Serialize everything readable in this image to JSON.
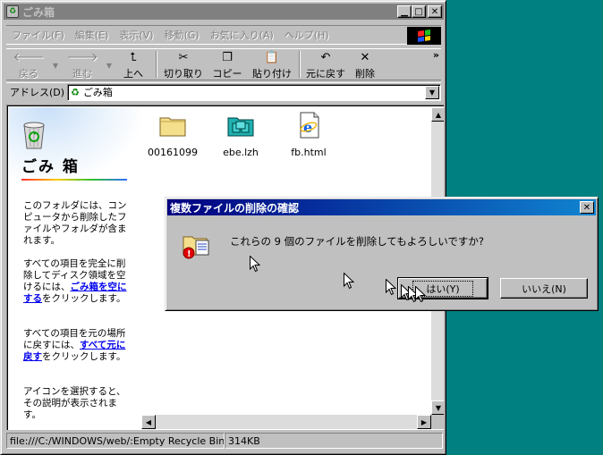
{
  "window": {
    "title": "ごみ箱",
    "menu": [
      "ファイル(F)",
      "編集(E)",
      "表示(V)",
      "移動(G)",
      "お気に入り(A)",
      "ヘルプ(H)"
    ],
    "toolbar": {
      "back": "戻る",
      "forward": "進む",
      "up": "上へ",
      "cut": "切り取り",
      "copy": "コピー",
      "paste": "貼り付け",
      "undo": "元に戻す",
      "delete": "削除",
      "more": "»"
    },
    "address": {
      "label": "アドレス(D)",
      "value": "ごみ箱"
    }
  },
  "left_pane": {
    "heading": "ごみ 箱",
    "para1": "このフォルダには、コンピュータから削除したファイルやフォルダが含まれます。",
    "para2_pre": "すべての項目を完全に削除してディスク領域を空けるには、",
    "para2_link": "ごみ箱を空にする",
    "para2_post": "をクリックします。",
    "para3_pre": "すべての項目を元の場所に戻すには、",
    "para3_link": "すべて元に戻す",
    "para3_post": "をクリックします。",
    "para4": "アイコンを選択すると、その説明が表示されます。"
  },
  "files": [
    {
      "name": "00161099",
      "icon": "folder-icon"
    },
    {
      "name": "ebe.lzh",
      "icon": "archive-icon"
    },
    {
      "name": "fb.html",
      "icon": "ie-document-icon"
    }
  ],
  "status": {
    "path": "file:///C:/WINDOWS/web/:Empty Recycle Bin",
    "size": "314KB"
  },
  "dialog": {
    "title": "複数ファイルの削除の確認",
    "message": "これらの 9 個のファイルを削除してもよろしいですか?",
    "yes_label": "はい(Y)",
    "no_label": "いいえ(N)"
  },
  "colors": {
    "desktop": "#008080",
    "face": "#c0c0c0",
    "active_title": "#000080",
    "inactive_title": "#808080",
    "link": "#0000ee"
  }
}
